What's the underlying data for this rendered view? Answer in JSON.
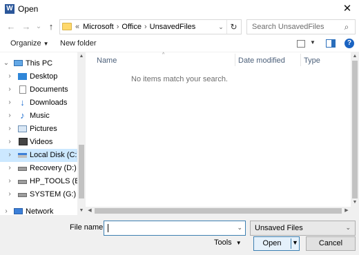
{
  "window": {
    "title": "Open",
    "app_icon_letter": "W",
    "close_glyph": "✕"
  },
  "nav": {
    "back_glyph": "←",
    "forward_glyph": "→",
    "recent_glyph": "⌄",
    "up_glyph": "↑",
    "breadcrumb_lead": "«",
    "breadcrumb": [
      "Microsoft",
      "Office",
      "UnsavedFiles"
    ],
    "breadcrumb_sep": "›",
    "dropdown_glyph": "⌄",
    "refresh_glyph": "↻",
    "search_placeholder": "Search UnsavedFiles",
    "search_glyph": "⌕"
  },
  "toolbar": {
    "organize_label": "Organize",
    "organize_caret": "▼",
    "new_folder_label": "New folder",
    "view_caret": "▼",
    "help_glyph": "?"
  },
  "tree": {
    "items": [
      {
        "label": "This PC",
        "icon": "this-pc-icon",
        "chevron": "⌄"
      },
      {
        "label": "Desktop",
        "icon": "desktop-icon",
        "chevron": "›"
      },
      {
        "label": "Documents",
        "icon": "documents-icon",
        "chevron": "›"
      },
      {
        "label": "Downloads",
        "icon": "downloads-icon",
        "chevron": "›",
        "glyph": "↓"
      },
      {
        "label": "Music",
        "icon": "music-icon",
        "chevron": "›",
        "glyph": "♪"
      },
      {
        "label": "Pictures",
        "icon": "pictures-icon",
        "chevron": "›"
      },
      {
        "label": "Videos",
        "icon": "videos-icon",
        "chevron": "›"
      },
      {
        "label": "Local Disk (C:)",
        "icon": "local-disk-icon",
        "chevron": "›",
        "selected": true
      },
      {
        "label": "Recovery (D:)",
        "icon": "drive-icon",
        "chevron": "›"
      },
      {
        "label": "HP_TOOLS (E:)",
        "icon": "drive-icon",
        "chevron": "›"
      },
      {
        "label": "SYSTEM (G:)",
        "icon": "drive-icon",
        "chevron": "›"
      },
      {
        "label": "Network",
        "icon": "network-icon",
        "chevron": "›"
      }
    ]
  },
  "file_list": {
    "columns": [
      "Name",
      "Date modified",
      "Type"
    ],
    "sort_glyph": "^",
    "empty_message": "No items match your search."
  },
  "scroll_glyphs": {
    "up": "▲",
    "down": "▼",
    "left": "◀",
    "right": "▶"
  },
  "footer": {
    "file_name_label": "File name:",
    "file_name_value": "",
    "file_name_dd": "⌄",
    "file_type_value": "Unsaved Files",
    "file_type_dd": "⌄",
    "tools_label": "Tools",
    "tools_caret": "▼",
    "open_label": "Open",
    "open_caret": "▼",
    "cancel_label": "Cancel"
  },
  "colors": {
    "accent": "#3c7fb1",
    "selection": "#cce8ff",
    "header_text": "#4c607a"
  }
}
